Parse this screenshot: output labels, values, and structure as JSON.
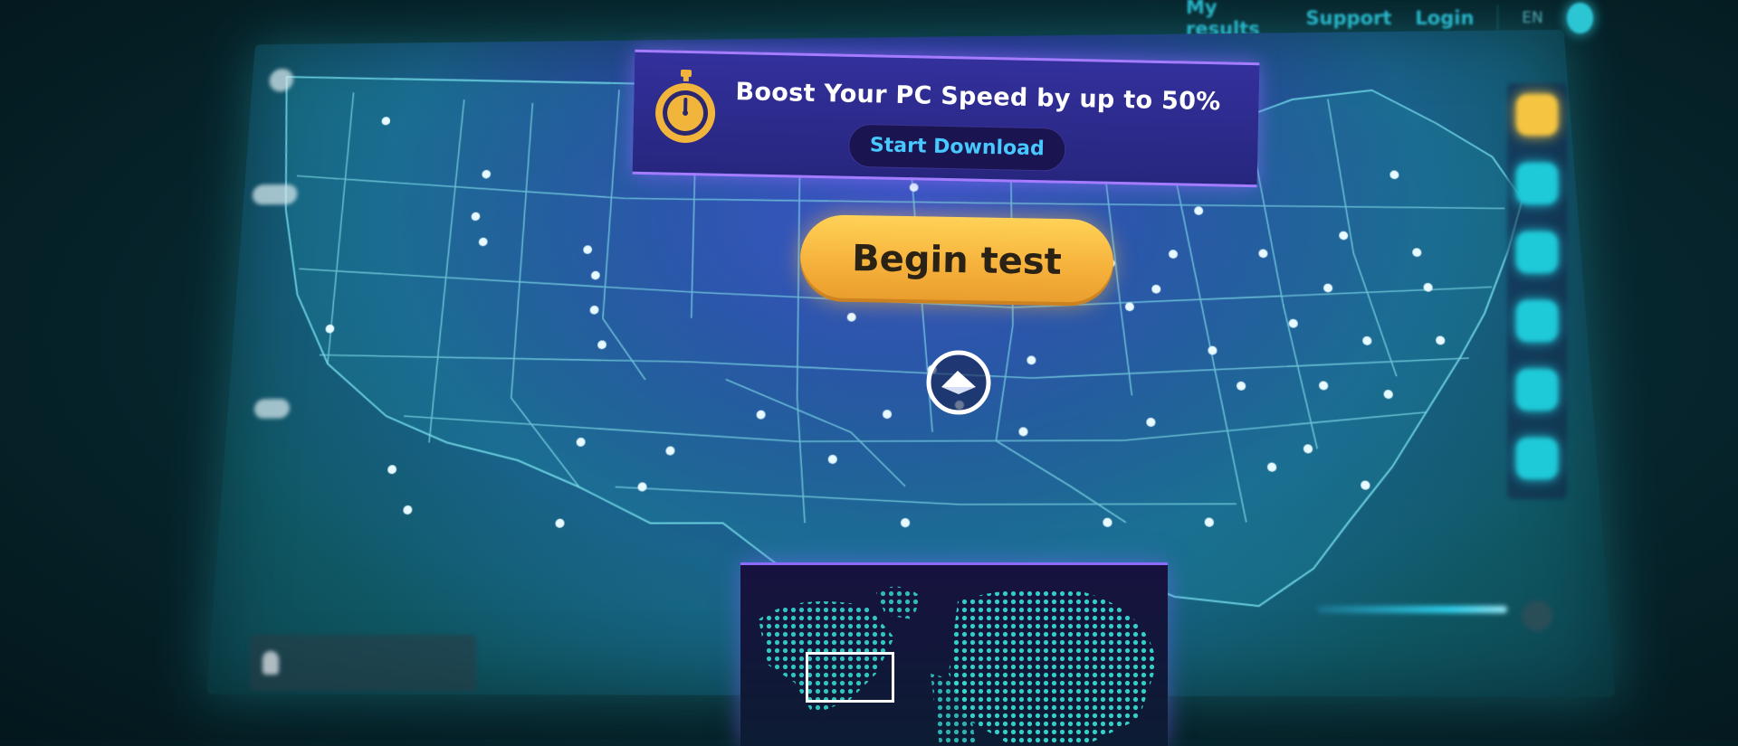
{
  "nav": {
    "links": [
      "My results",
      "Support",
      "Login"
    ],
    "language": "EN"
  },
  "promo": {
    "headline": "Boost Your PC Speed by up to 50%",
    "button_label": "Start Download"
  },
  "main": {
    "begin_button": "Begin test"
  },
  "colors": {
    "accent_yellow": "#f6b23c",
    "accent_cyan": "#2cc6d4",
    "accent_purple": "#a57cff"
  },
  "icons": [
    "stopwatch-icon",
    "location-marker-icon",
    "user-icon"
  ]
}
